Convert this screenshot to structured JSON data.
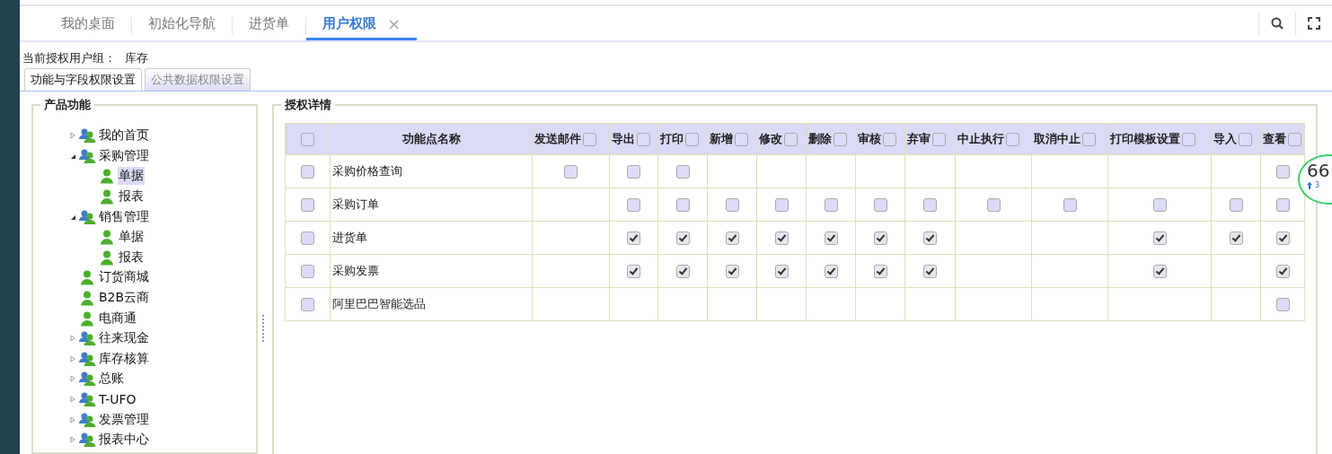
{
  "tabs": [
    {
      "label": "我的桌面",
      "selected": false,
      "closable": false
    },
    {
      "label": "初始化导航",
      "selected": false,
      "closable": false
    },
    {
      "label": "进货单",
      "selected": false,
      "closable": false
    },
    {
      "label": "用户权限",
      "selected": true,
      "closable": true
    }
  ],
  "close_glyph": "×",
  "user_group": {
    "label": "当前授权用户组：",
    "value": "库存"
  },
  "sub_tabs": [
    {
      "label": "功能与字段权限设置",
      "selected": true
    },
    {
      "label": "公共数据权限设置",
      "selected": false
    }
  ],
  "tree_panel": {
    "title": "产品功能",
    "items": [
      {
        "label": "我的首页",
        "kind": "group",
        "expanded": false,
        "selected": false
      },
      {
        "label": "采购管理",
        "kind": "group",
        "expanded": true,
        "selected": false,
        "children": [
          {
            "label": "单据",
            "kind": "user",
            "selected": true
          },
          {
            "label": "报表",
            "kind": "user",
            "selected": false
          }
        ]
      },
      {
        "label": "销售管理",
        "kind": "group",
        "expanded": true,
        "selected": false,
        "children": [
          {
            "label": "单据",
            "kind": "user",
            "selected": false
          },
          {
            "label": "报表",
            "kind": "user",
            "selected": false
          }
        ]
      },
      {
        "label": "订货商城",
        "kind": "user",
        "selected": false
      },
      {
        "label": "B2B云商",
        "kind": "user",
        "selected": false
      },
      {
        "label": "电商通",
        "kind": "user",
        "selected": false
      },
      {
        "label": "往来现金",
        "kind": "group",
        "expanded": false,
        "selected": false
      },
      {
        "label": "库存核算",
        "kind": "group",
        "expanded": false,
        "selected": false
      },
      {
        "label": "总账",
        "kind": "group",
        "expanded": false,
        "selected": false
      },
      {
        "label": "T-UFO",
        "kind": "group",
        "expanded": false,
        "selected": false
      },
      {
        "label": "发票管理",
        "kind": "group",
        "expanded": false,
        "selected": false
      },
      {
        "label": "报表中心",
        "kind": "group",
        "expanded": false,
        "selected": false
      }
    ]
  },
  "detail_panel": {
    "title": "授权详情",
    "select_all_checked": false,
    "name_column": "功能点名称",
    "columns": [
      {
        "label": "发送邮件",
        "checked": false
      },
      {
        "label": "导出",
        "checked": false
      },
      {
        "label": "打印",
        "checked": false
      },
      {
        "label": "新增",
        "checked": false
      },
      {
        "label": "修改",
        "checked": false
      },
      {
        "label": "删除",
        "checked": false
      },
      {
        "label": "审核",
        "checked": false
      },
      {
        "label": "弃审",
        "checked": false
      },
      {
        "label": "中止执行",
        "checked": false
      },
      {
        "label": "取消中止",
        "checked": false
      },
      {
        "label": "打印模板设置",
        "checked": false
      },
      {
        "label": "导入",
        "checked": false
      },
      {
        "label": "查看",
        "checked": false
      }
    ],
    "rows": [
      {
        "name": "采购价格查询",
        "checked": false,
        "cells": [
          false,
          false,
          false,
          null,
          null,
          null,
          null,
          null,
          null,
          null,
          null,
          null,
          false
        ]
      },
      {
        "name": "采购订单",
        "checked": false,
        "cells": [
          null,
          false,
          false,
          false,
          false,
          false,
          false,
          false,
          false,
          false,
          false,
          false,
          false
        ]
      },
      {
        "name": "进货单",
        "checked": false,
        "cells": [
          null,
          true,
          true,
          true,
          true,
          true,
          true,
          true,
          null,
          null,
          true,
          true,
          true
        ]
      },
      {
        "name": "采购发票",
        "checked": false,
        "cells": [
          null,
          true,
          true,
          true,
          true,
          true,
          true,
          true,
          null,
          null,
          true,
          null,
          true
        ]
      },
      {
        "name": "阿里巴巴智能选品",
        "checked": false,
        "cells": [
          null,
          null,
          null,
          null,
          null,
          null,
          null,
          null,
          null,
          null,
          null,
          null,
          false
        ]
      }
    ]
  },
  "speed_badge": {
    "value": "66",
    "sub": "3"
  }
}
